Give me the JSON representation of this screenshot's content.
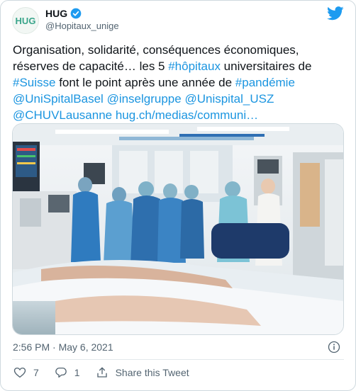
{
  "author": {
    "name": "HUG",
    "handle": "@Hopitaux_unige",
    "logo_text": "HUG",
    "verified": true
  },
  "tweet": {
    "line1": "Organisation, solidarité, conséquences économiques,",
    "line2": "réserves de capacité… les 5 ",
    "hashtag_hopitaux": "#hôpitaux",
    "line2_rest": " universitaires de",
    "hashtag_suisse": "#Suisse",
    "line3_mid": " font le point après une année de ",
    "hashtag_pandemie": "#pandémie",
    "mention1": "@UniSpitalBasel",
    "mention2": "@inselgruppe",
    "mention3": "@Unispital_USZ",
    "mention4": "@CHUVLausanne",
    "url": "hug.ch/medias/communi…"
  },
  "timestamp": "2:56 PM · May 6, 2021",
  "actions": {
    "like_count": "7",
    "reply_count": "1",
    "share_label": "Share this Tweet"
  },
  "colors": {
    "link": "#1b95e0",
    "twitter_blue": "#1d9bf0",
    "secondary_text": "#536471",
    "brand_green": "#3aa58b"
  },
  "icons": [
    "hug-logo-icon",
    "verified-badge-icon",
    "twitter-bird-icon",
    "info-icon",
    "heart-icon",
    "reply-icon",
    "share-icon"
  ]
}
